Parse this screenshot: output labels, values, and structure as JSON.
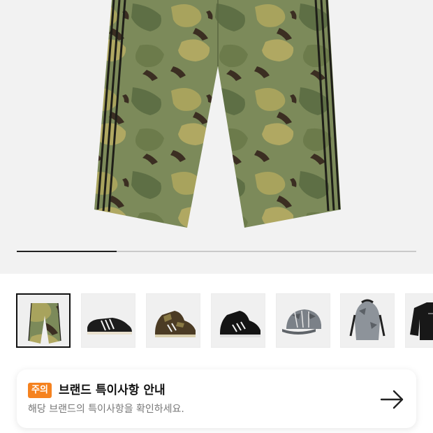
{
  "gallery": {
    "progress": 0.25,
    "thumbnails": [
      {
        "icon": "camo-pants-icon",
        "selected": true
      },
      {
        "icon": "sneaker-superstar-icon",
        "selected": false
      },
      {
        "icon": "camo-sneaker-icon",
        "selected": false
      },
      {
        "icon": "black-sneaker-icon",
        "selected": false
      },
      {
        "icon": "camo-cap-icon",
        "selected": false
      },
      {
        "icon": "camo-bag-icon",
        "selected": false
      },
      {
        "icon": "black-jacket-icon",
        "selected": false
      }
    ]
  },
  "notice": {
    "badge": "주의",
    "title": "브랜드 특이사항 안내",
    "description": "해당 브랜드의 특이사항을 확인하세요."
  },
  "colors": {
    "accent": "#f5821f",
    "camo_base": "#7c8a5a",
    "camo_light": "#a6a05a",
    "camo_dark": "#3b2e22"
  }
}
